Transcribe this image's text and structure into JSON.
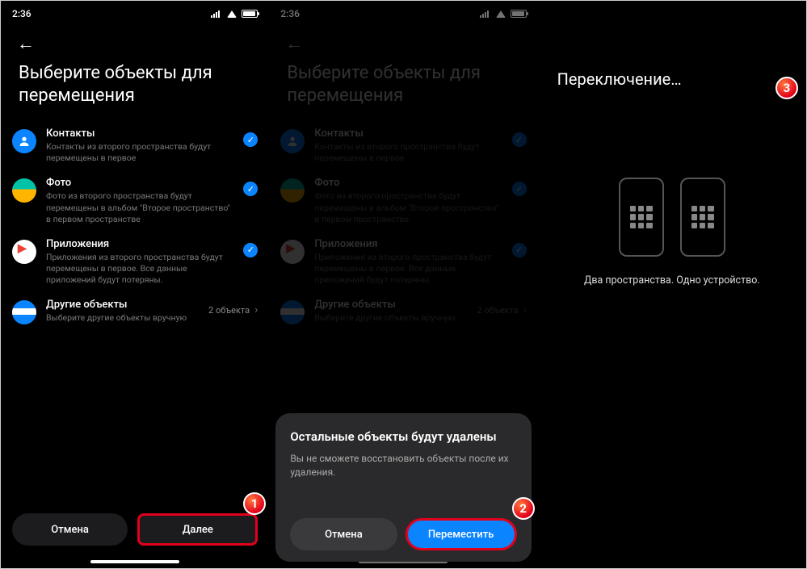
{
  "statusbar": {
    "time": "2:36"
  },
  "screen1": {
    "title": "Выберите объекты для перемещения",
    "items": {
      "contacts": {
        "title": "Контакты",
        "desc": "Контакты из второго пространства будут перемещены в первое"
      },
      "photo": {
        "title": "Фото",
        "desc": "Фото из второго пространства будут перемещены в альбом \"Второе пространство\" в первом пространстве"
      },
      "apps": {
        "title": "Приложения",
        "desc": "Приложения из второго пространства будут перемещены в первое. Все данные приложений будут потеряны."
      },
      "other": {
        "title": "Другие объекты",
        "desc": "Выберите другие объекты вручную",
        "count": "2 объекта"
      }
    },
    "buttons": {
      "cancel": "Отмена",
      "next": "Далее"
    }
  },
  "screen2": {
    "dialog": {
      "title": "Остальные объекты будут удалены",
      "desc": "Вы не сможете восстановить объекты после их удаления.",
      "cancel": "Отмена",
      "confirm": "Переместить"
    }
  },
  "screen3": {
    "title": "Переключение…",
    "caption": "Два пространства. Одно устройство."
  },
  "badges": {
    "b1": "1",
    "b2": "2",
    "b3": "3"
  }
}
